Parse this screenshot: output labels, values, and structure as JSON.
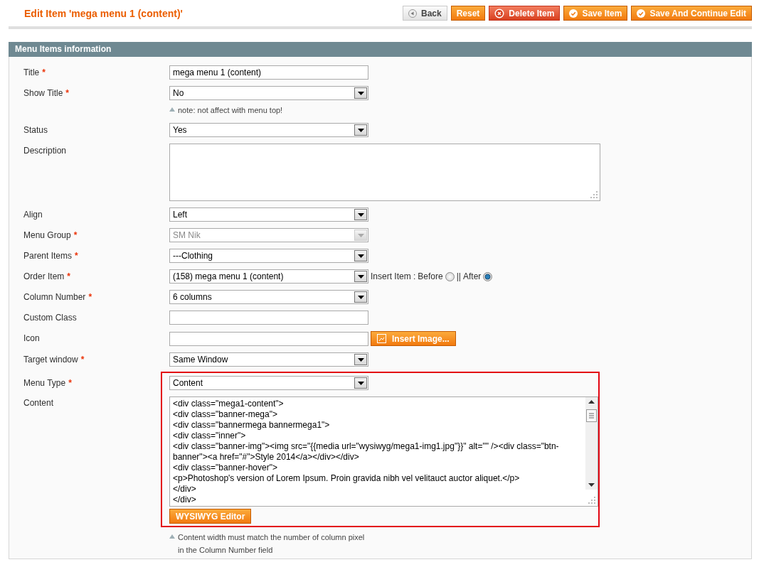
{
  "header": {
    "title": "Edit Item 'mega menu 1 (content)'",
    "buttons": [
      {
        "label": "Back",
        "kind": "back"
      },
      {
        "label": "Reset",
        "kind": "plain"
      },
      {
        "label": "Delete Item",
        "kind": "delete"
      },
      {
        "label": "Save Item",
        "kind": "save"
      },
      {
        "label": "Save And Continue Edit",
        "kind": "save"
      }
    ]
  },
  "section": {
    "title": "Menu Items information",
    "fields": [
      {
        "label": "Title",
        "asterisk": "*",
        "kind": "text",
        "value": "mega menu 1 (content)"
      },
      {
        "label": "Show Title",
        "asterisk": "*",
        "kind": "select",
        "value": "No",
        "note": "note: not affect with menu top!"
      },
      {
        "label": "Status",
        "kind": "select",
        "value": "Yes"
      },
      {
        "label": "Description",
        "kind": "textarea"
      },
      {
        "label": "Align",
        "kind": "select",
        "value": "Left"
      },
      {
        "label": "Menu Group",
        "asterisk": "*",
        "kind": "select",
        "value": "SM Nik",
        "disabled": true
      },
      {
        "label": "Parent Items",
        "asterisk": "*",
        "kind": "select",
        "value": "---Clothing"
      },
      {
        "label": "Order Item",
        "asterisk": "*",
        "kind": "select",
        "value": "(158) mega menu 1 (content)",
        "insert": {
          "prefix": "Insert Item :",
          "separator": "||",
          "radios": [
            {
              "label": "Before",
              "selected": false
            },
            {
              "label": "After",
              "selected": true
            }
          ]
        }
      },
      {
        "label": "Column Number",
        "asterisk": "*",
        "kind": "select",
        "value": "6 columns"
      },
      {
        "label": "Custom Class",
        "kind": "text"
      },
      {
        "label": "Icon",
        "kind": "text",
        "button": "Insert Image..."
      },
      {
        "label": "Target window",
        "asterisk": "*",
        "kind": "select",
        "value": "Same Window"
      },
      {
        "label": "Menu Type",
        "asterisk": "*",
        "kind": "select",
        "value": "Content",
        "highlighted": true
      },
      {
        "label": "Content",
        "kind": "editor",
        "highlighted": true,
        "button": "WYSIWYG Editor",
        "note": "Content width must match the number of column pixel in the Column Number field",
        "lines": [
          "<div class=\"mega1-content\">",
          "<div class=\"banner-mega\">",
          "<div class=\"bannermega bannermega1\">",
          "<div class=\"inner\">",
          "<div class=\"banner-img\"><img src=\"{{media url=\"wysiwyg/mega1-img1.jpg\"}}\" alt=\"\" /><div class=\"btn-",
          "banner\"><a href=\"#\">Style 2014</a></div></div>",
          "<div class=\"banner-hover\">",
          "<p>Photoshop's version of Lorem Ipsum. Proin gravida nibh vel velitauct auctor aliquet.</p>",
          "</div>",
          "</div>"
        ]
      }
    ]
  }
}
